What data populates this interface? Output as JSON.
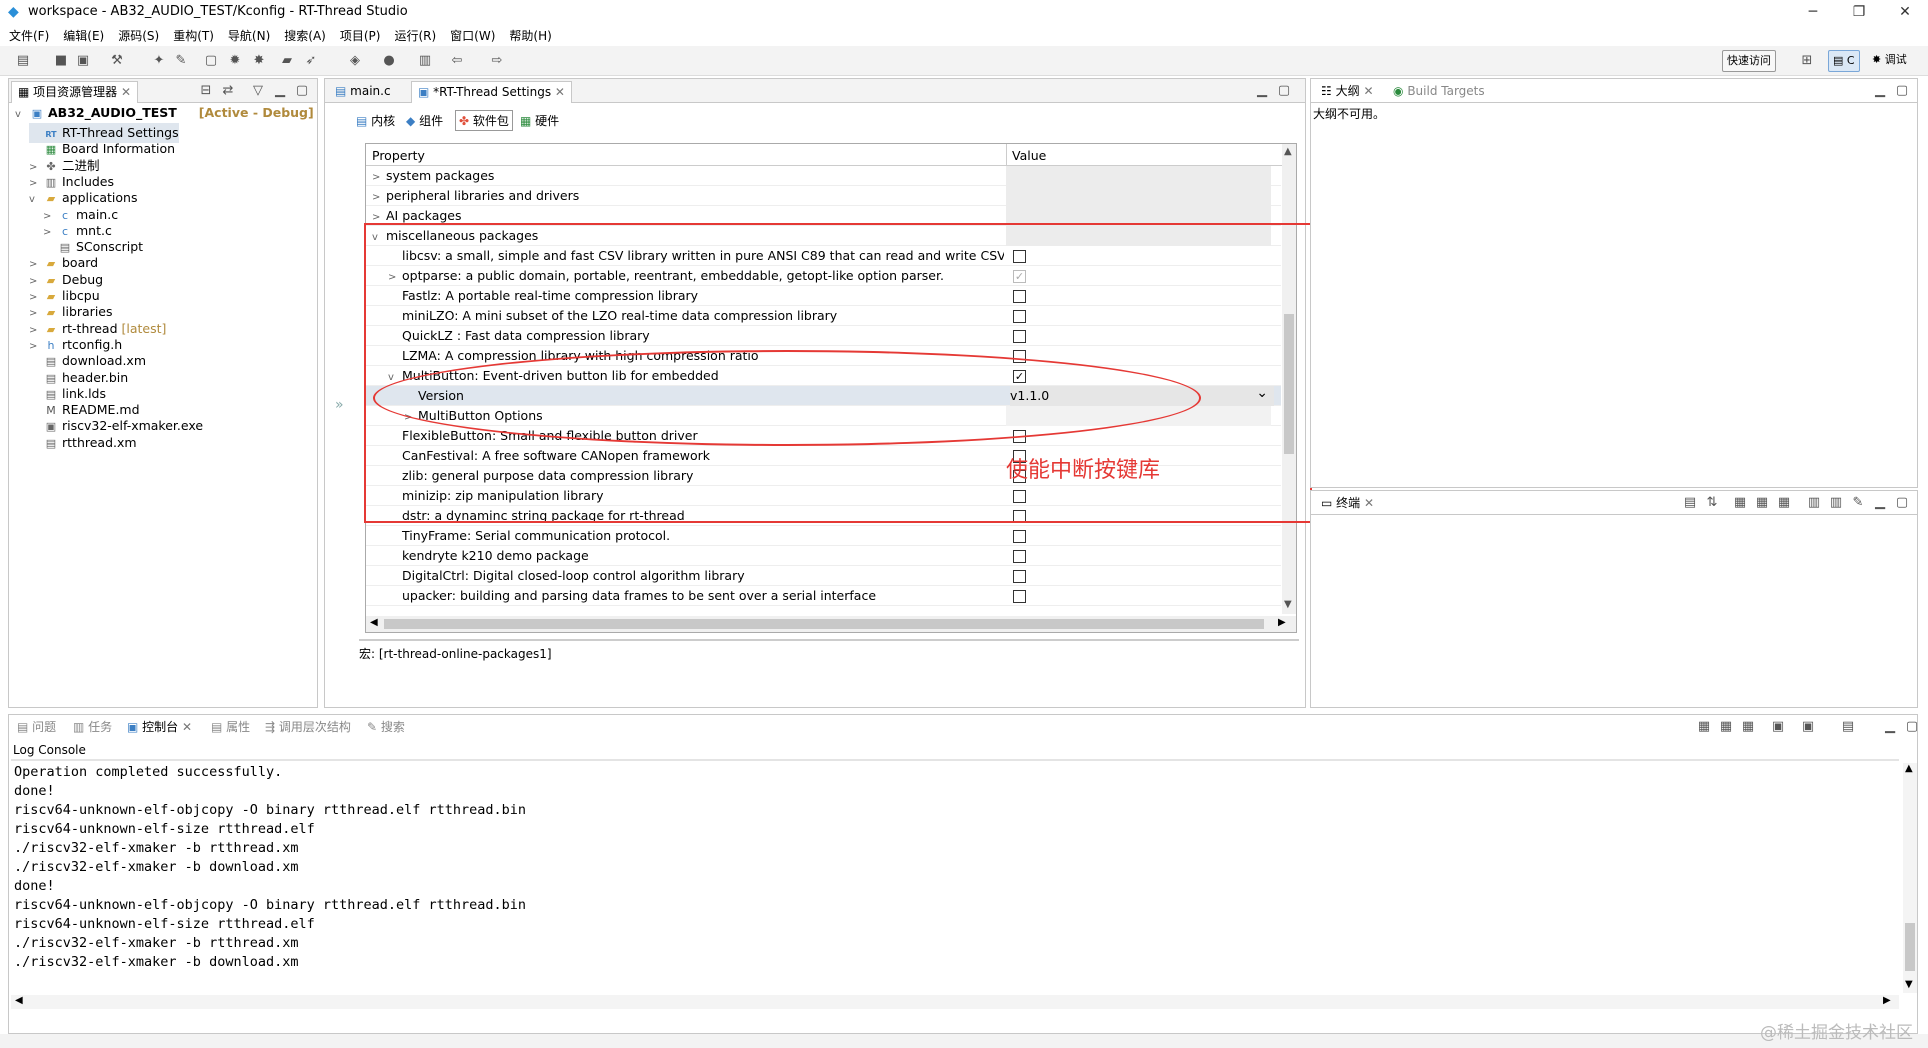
{
  "window": {
    "title": "workspace - AB32_AUDIO_TEST/Kconfig - RT-Thread Studio",
    "minimize": "─",
    "restore": "❐",
    "close": "✕"
  },
  "menu": [
    "文件(F)",
    "编辑(E)",
    "源码(S)",
    "重构(T)",
    "导航(N)",
    "搜索(A)",
    "项目(P)",
    "运行(R)",
    "窗口(W)",
    "帮助(H)"
  ],
  "toolbar": {
    "quick_access": "快速访问",
    "perspective_c": "C",
    "perspective_debug": "调试"
  },
  "explorer": {
    "title": "项目资源管理器",
    "project": {
      "name": "AB32_AUDIO_TEST",
      "status": "[Active - Debug]"
    },
    "items": [
      {
        "label": "RT-Thread Settings",
        "icon": "rt-settings-icon",
        "indent": 1,
        "twisty": "",
        "selected": true
      },
      {
        "label": "Board Information",
        "icon": "board-icon",
        "indent": 1,
        "twisty": ""
      },
      {
        "label": "二进制",
        "icon": "binary-icon",
        "indent": 1,
        "twisty": ">"
      },
      {
        "label": "Includes",
        "icon": "includes-icon",
        "indent": 1,
        "twisty": ">"
      },
      {
        "label": "applications",
        "icon": "folder-icon",
        "indent": 1,
        "twisty": "v"
      },
      {
        "label": "main.c",
        "icon": "c-file-icon",
        "indent": 2,
        "twisty": ">"
      },
      {
        "label": "mnt.c",
        "icon": "c-file-icon",
        "indent": 2,
        "twisty": ">"
      },
      {
        "label": "SConscript",
        "icon": "file-icon",
        "indent": 2,
        "twisty": ""
      },
      {
        "label": "board",
        "icon": "folder-icon",
        "indent": 1,
        "twisty": ">"
      },
      {
        "label": "Debug",
        "icon": "folder-icon",
        "indent": 1,
        "twisty": ">"
      },
      {
        "label": "libcpu",
        "icon": "folder-icon",
        "indent": 1,
        "twisty": ">"
      },
      {
        "label": "libraries",
        "icon": "folder-icon",
        "indent": 1,
        "twisty": ">"
      },
      {
        "label": "rt-thread",
        "suffix": "[latest]",
        "icon": "folder-icon",
        "indent": 1,
        "twisty": ">"
      },
      {
        "label": "rtconfig.h",
        "icon": "h-file-icon",
        "indent": 1,
        "twisty": ">"
      },
      {
        "label": "download.xm",
        "icon": "file-icon",
        "indent": 1,
        "twisty": ""
      },
      {
        "label": "header.bin",
        "icon": "file-icon",
        "indent": 1,
        "twisty": ""
      },
      {
        "label": "link.lds",
        "icon": "file-icon",
        "indent": 1,
        "twisty": ""
      },
      {
        "label": "README.md",
        "icon": "md-file-icon",
        "indent": 1,
        "twisty": ""
      },
      {
        "label": "riscv32-elf-xmaker.exe",
        "icon": "exe-file-icon",
        "indent": 1,
        "twisty": ""
      },
      {
        "label": "rtthread.xm",
        "icon": "file-icon",
        "indent": 1,
        "twisty": ""
      }
    ]
  },
  "editor": {
    "tabs": [
      {
        "label": "main.c"
      },
      {
        "label": "*RT-Thread Settings"
      }
    ],
    "subtabs": [
      "内核",
      "组件",
      "软件包",
      "硬件"
    ],
    "headers": {
      "property": "Property",
      "value": "Value"
    },
    "rows": [
      {
        "label": "system packages",
        "indent": 1,
        "twisty": ">",
        "cb": "none"
      },
      {
        "label": "peripheral libraries and drivers",
        "indent": 1,
        "twisty": ">",
        "cb": "none"
      },
      {
        "label": "AI packages",
        "indent": 1,
        "twisty": ">",
        "cb": "none"
      },
      {
        "label": "miscellaneous packages",
        "indent": 1,
        "twisty": "v",
        "cb": "none"
      },
      {
        "label": "libcsv: a small, simple and fast CSV library written in pure ANSI C89 that can read and write CSV data.",
        "indent": 2,
        "twisty": "",
        "cb": "unchecked"
      },
      {
        "label": "optparse: a public domain, portable, reentrant, embeddable, getopt-like option parser.",
        "indent": 2,
        "twisty": ">",
        "cb": "disabled"
      },
      {
        "label": "Fastlz: A portable real-time compression library",
        "indent": 2,
        "twisty": "",
        "cb": "unchecked"
      },
      {
        "label": "miniLZO: A mini subset of the LZO real-time data compression library",
        "indent": 2,
        "twisty": "",
        "cb": "unchecked"
      },
      {
        "label": "QuickLZ : Fast data compression library",
        "indent": 2,
        "twisty": "",
        "cb": "unchecked"
      },
      {
        "label": "LZMA: A compression library with high compression ratio",
        "indent": 2,
        "twisty": "",
        "cb": "unchecked"
      },
      {
        "label": "MultiButton: Event-driven button lib for embedded",
        "indent": 2,
        "twisty": "v",
        "cb": "checked"
      },
      {
        "label": "Version",
        "indent": 3,
        "twisty": "",
        "cb": "select",
        "value": "v1.1.0",
        "selected": true
      },
      {
        "label": "MultiButton Options",
        "indent": 3,
        "twisty": ">",
        "cb": "none"
      },
      {
        "label": "FlexibleButton: Small and flexible button driver",
        "indent": 2,
        "twisty": "",
        "cb": "unchecked"
      },
      {
        "label": "CanFestival: A free software CANopen framework",
        "indent": 2,
        "twisty": "",
        "cb": "unchecked"
      },
      {
        "label": "zlib: general purpose data compression library",
        "indent": 2,
        "twisty": "",
        "cb": "unchecked"
      },
      {
        "label": "minizip: zip manipulation library",
        "indent": 2,
        "twisty": "",
        "cb": "unchecked"
      },
      {
        "label": "dstr: a dynaminc string package for rt-thread",
        "indent": 2,
        "twisty": "",
        "cb": "unchecked"
      },
      {
        "label": "TinyFrame: Serial communication protocol.",
        "indent": 2,
        "twisty": "",
        "cb": "unchecked"
      },
      {
        "label": "kendryte k210 demo package",
        "indent": 2,
        "twisty": "",
        "cb": "unchecked"
      },
      {
        "label": "DigitalCtrl: Digital closed-loop control algorithm library",
        "indent": 2,
        "twisty": "",
        "cb": "unchecked"
      },
      {
        "label": "upacker: building and parsing data frames to be sent over a serial interface",
        "indent": 2,
        "twisty": "",
        "cb": "unchecked"
      }
    ],
    "macro_text": "宏: [rt-thread-online-packages1]",
    "annotation": "使能中断按键库"
  },
  "outline": {
    "tabs": [
      "大纲",
      "Build Targets"
    ],
    "message": "大纲不可用。"
  },
  "terminal": {
    "title": "终端"
  },
  "bottom": {
    "tabs": [
      "问题",
      "任务",
      "控制台",
      "属性",
      "调用层次结构",
      "搜索"
    ],
    "console_title": "Log Console",
    "lines": [
      "Operation completed successfully.",
      "done!",
      "riscv64-unknown-elf-objcopy -O binary rtthread.elf rtthread.bin",
      "riscv64-unknown-elf-size rtthread.elf",
      "./riscv32-elf-xmaker -b rtthread.xm",
      "./riscv32-elf-xmaker -b download.xm",
      "done!",
      "riscv64-unknown-elf-objcopy -O binary rtthread.elf rtthread.bin",
      "riscv64-unknown-elf-size rtthread.elf",
      "./riscv32-elf-xmaker -b rtthread.xm",
      "./riscv32-elf-xmaker -b download.xm"
    ]
  },
  "watermark": "@稀土掘金技术社区",
  "colors": {
    "annotation_red": "#e53935",
    "accent_blue": "#3c7fc4",
    "selected_row": "#dfe6ee"
  }
}
